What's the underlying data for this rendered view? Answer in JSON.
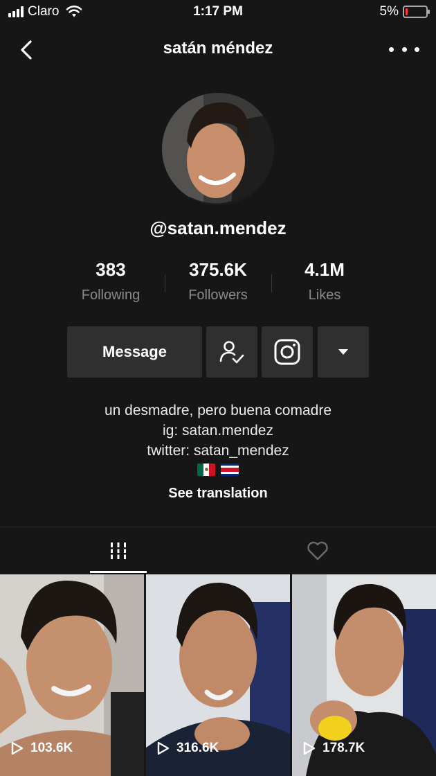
{
  "status": {
    "carrier": "Claro",
    "time": "1:17 PM",
    "battery_percent": "5%",
    "battery_level": 0.05,
    "battery_color": "#ff3b30"
  },
  "nav": {
    "title": "satán méndez",
    "back_icon": "chevron-left-icon",
    "more_icon": "more-dots-icon"
  },
  "profile": {
    "username": "@satan.mendez",
    "stats": [
      {
        "value": "383",
        "label": "Following"
      },
      {
        "value": "375.6K",
        "label": "Followers"
      },
      {
        "value": "4.1M",
        "label": "Likes"
      }
    ]
  },
  "actions": {
    "message_label": "Message",
    "follow_icon": "person-check-icon",
    "instagram_icon": "instagram-icon",
    "dropdown_icon": "caret-down-icon"
  },
  "bio": {
    "lines": [
      "un desmadre, pero buena comadre",
      "ig: satan.mendez",
      "twitter: satan_mendez"
    ],
    "flags": [
      "mexico-flag",
      "costa-rica-flag"
    ],
    "see_translation": "See translation"
  },
  "tabs": [
    {
      "name": "videos",
      "icon": "grid-bars-icon",
      "active": true
    },
    {
      "name": "liked",
      "icon": "heart-outline-icon",
      "active": false
    }
  ],
  "videos": [
    {
      "views": "103.6K"
    },
    {
      "views": "316.6K"
    },
    {
      "views": "178.7K"
    }
  ]
}
